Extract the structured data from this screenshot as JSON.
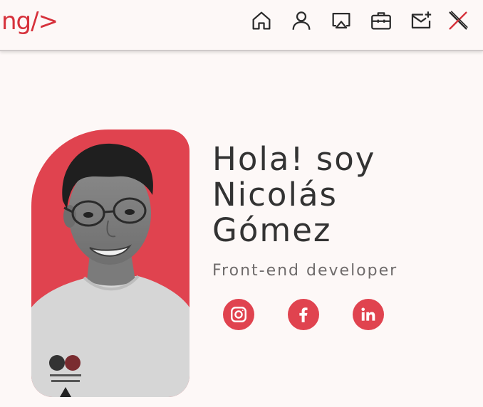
{
  "header": {
    "logo_text": "ng/>",
    "nav": [
      {
        "icon": "home-icon",
        "label": "Inicio"
      },
      {
        "icon": "user-icon",
        "label": "Sobre mí"
      },
      {
        "icon": "airplay-icon",
        "label": "Proyectos"
      },
      {
        "icon": "briefcase-icon",
        "label": "Experiencia"
      },
      {
        "icon": "mail-plus-icon",
        "label": "Contacto"
      },
      {
        "icon": "close-icon",
        "label": "Cerrar"
      }
    ]
  },
  "hero": {
    "greeting_lines": [
      "Hola! soy",
      "Nicolás",
      "Gómez"
    ],
    "role": "Front-end developer",
    "social": [
      {
        "icon": "instagram-icon"
      },
      {
        "icon": "facebook-icon"
      },
      {
        "icon": "linkedin-icon"
      }
    ]
  },
  "colors": {
    "accent": "#e0434f",
    "logo": "#d6313b",
    "text": "#333333",
    "muted": "#6f6b6b",
    "background": "#fdf8f7"
  }
}
